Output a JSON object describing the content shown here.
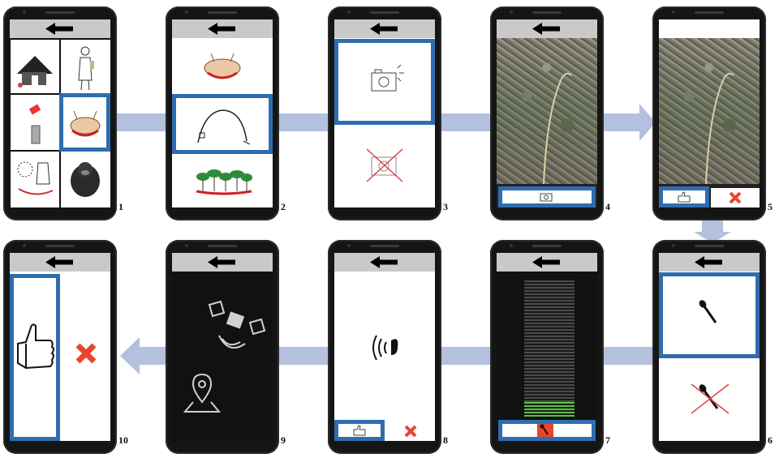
{
  "steps": [
    {
      "number": "1"
    },
    {
      "number": "2"
    },
    {
      "number": "3"
    },
    {
      "number": "4"
    },
    {
      "number": "5"
    },
    {
      "number": "6"
    },
    {
      "number": "7"
    },
    {
      "number": "8"
    },
    {
      "number": "9"
    },
    {
      "number": "10"
    }
  ],
  "colors": {
    "highlight": "#2f6db0",
    "flow_arrow": "#b3c0de",
    "phone_body": "#151515",
    "top_bar": "#c9c9c9",
    "cancel_red": "#e8452c",
    "level_green": "#58c43a"
  },
  "icons": [
    "back-arrow-icon",
    "hut-icon",
    "person-icon",
    "spray-icon",
    "animal-icon",
    "bag-icon",
    "gorilla-icon",
    "trap-icon",
    "forest-icon",
    "camera-icon",
    "thumbs-up-icon",
    "cancel-icon",
    "microphone-icon",
    "speaking-icon",
    "satellite-icon",
    "location-pin-icon"
  ]
}
